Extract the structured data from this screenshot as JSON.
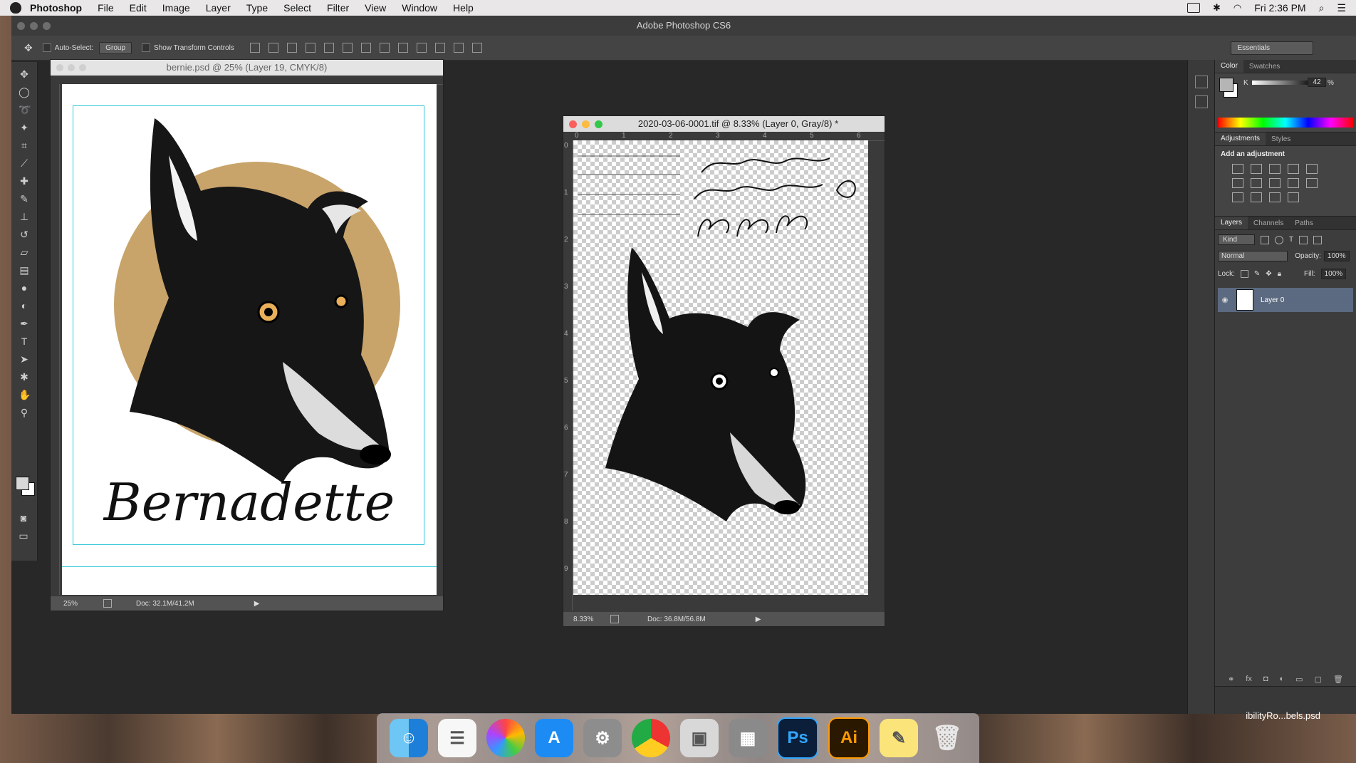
{
  "menubar": {
    "app_name": "Photoshop",
    "items": [
      "File",
      "Edit",
      "Image",
      "Layer",
      "Type",
      "Select",
      "Filter",
      "View",
      "Window",
      "Help"
    ],
    "clock": "Fri 2:36 PM"
  },
  "app": {
    "window_title": "Adobe Photoshop CS6",
    "options": {
      "auto_select_label": "Auto-Select:",
      "auto_select_value": "Group",
      "transform_label": "Show Transform Controls",
      "workspace": "Essentials"
    }
  },
  "doc1": {
    "title": "bernie.psd @ 25% (Layer 19, CMYK/8)",
    "zoom": "25%",
    "doc_size": "Doc: 32.1M/41.2M",
    "script_text": "Bernadette",
    "circle_color": "#c8a46a"
  },
  "doc2": {
    "title": "2020-03-06-0001.tif @ 8.33% (Layer 0, Gray/8) *",
    "zoom": "8.33%",
    "doc_size": "Doc: 36.8M/56.8M",
    "ruler_h": [
      "0",
      "1",
      "2",
      "3",
      "4",
      "5",
      "6"
    ],
    "ruler_v": [
      "0",
      "1",
      "2",
      "3",
      "4",
      "5",
      "6",
      "7",
      "8",
      "9"
    ]
  },
  "color_panel": {
    "tabs": [
      "Color",
      "Swatches"
    ],
    "channel": "K",
    "value": "42",
    "unit": "%"
  },
  "adjustments_panel": {
    "tabs": [
      "Adjustments",
      "Styles"
    ],
    "heading": "Add an adjustment"
  },
  "layers_panel": {
    "tabs": [
      "Layers",
      "Channels",
      "Paths"
    ],
    "kind_label": "Kind",
    "blend_mode": "Normal",
    "opacity_label": "Opacity:",
    "opacity_value": "100%",
    "lock_label": "Lock:",
    "fill_label": "Fill:",
    "fill_value": "100%",
    "layer_name": "Layer 0"
  },
  "dock": {
    "ps_label": "Ps",
    "ai_label": "Ai"
  },
  "desktop": {
    "file_label": "ibilityRo...bels.psd"
  }
}
